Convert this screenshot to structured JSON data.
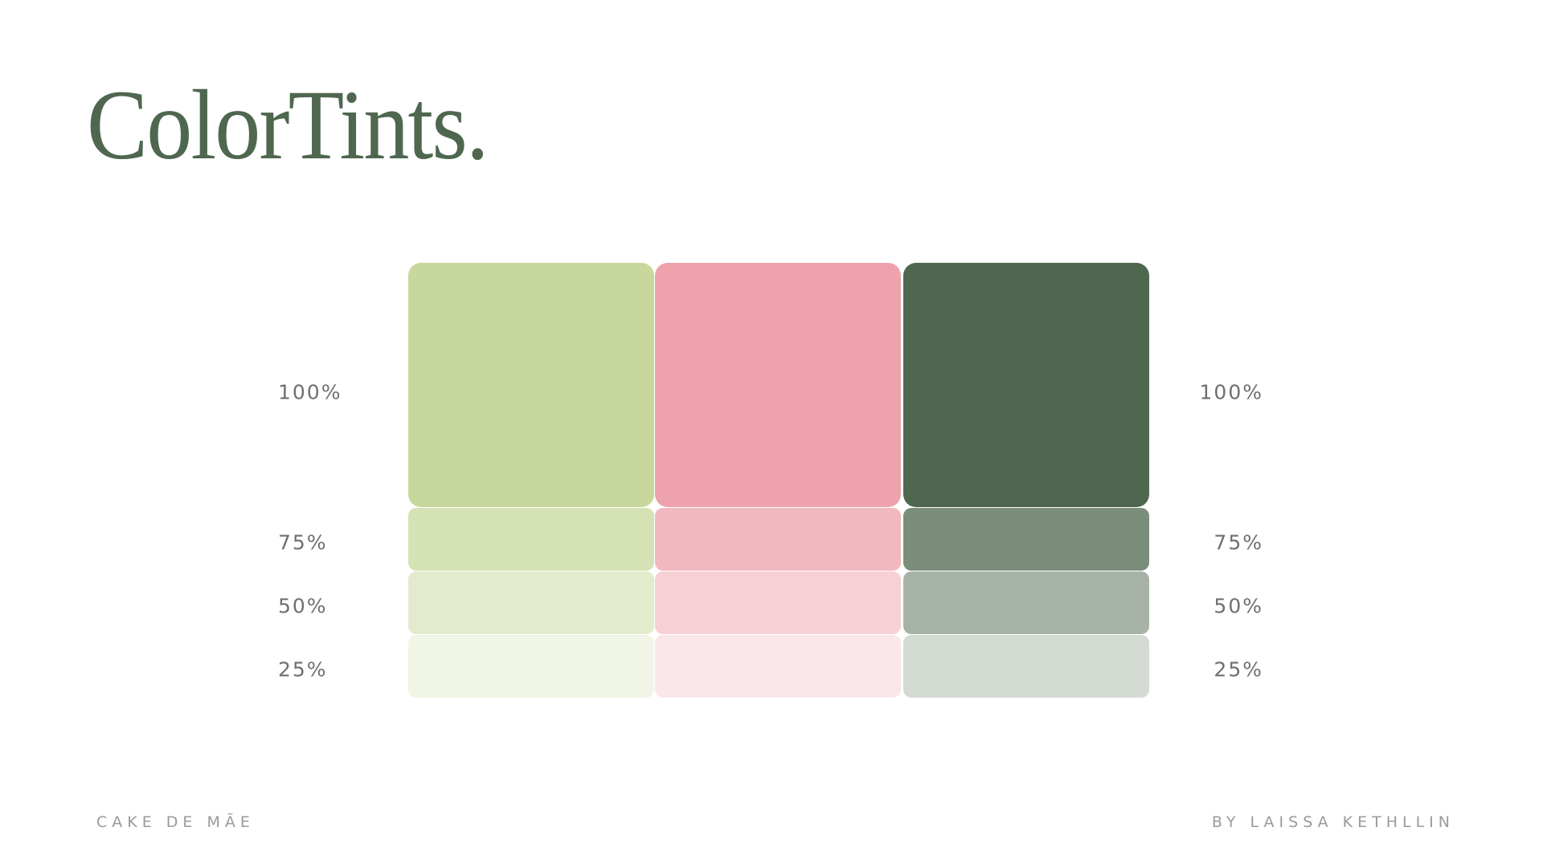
{
  "title": "ColorTints.",
  "palette": [
    {
      "tints": [
        "#c8d89c",
        "#d4e2b5",
        "#e3ebcd",
        "#f1f5e6"
      ]
    },
    {
      "tints": [
        "#eea3ac",
        "#f2b8bf",
        "#f6d0d5",
        "#fae7e9"
      ]
    },
    {
      "tints": [
        "#4f674f",
        "#7b8d7b",
        "#a7b2a7",
        "#d3dbd3"
      ]
    }
  ],
  "levels": [
    "100%",
    "75%",
    "50%",
    "25%"
  ],
  "footer": {
    "left": "CAKE DE MÃE",
    "right": "BY LAISSA KETHLLIN"
  }
}
